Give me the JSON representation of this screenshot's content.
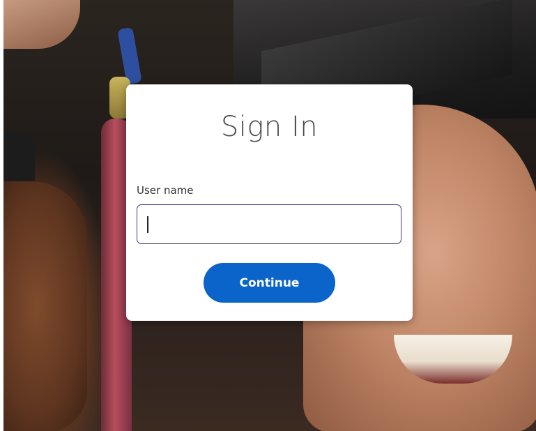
{
  "signin": {
    "title": "Sign In",
    "username_label": "User name",
    "username_value": "",
    "continue_label": "Continue"
  },
  "colors": {
    "primary_button": "#0a64c9",
    "input_border": "#3d3a7a",
    "card_background": "#ffffff",
    "title_text": "#4a4a4a"
  },
  "icons": []
}
